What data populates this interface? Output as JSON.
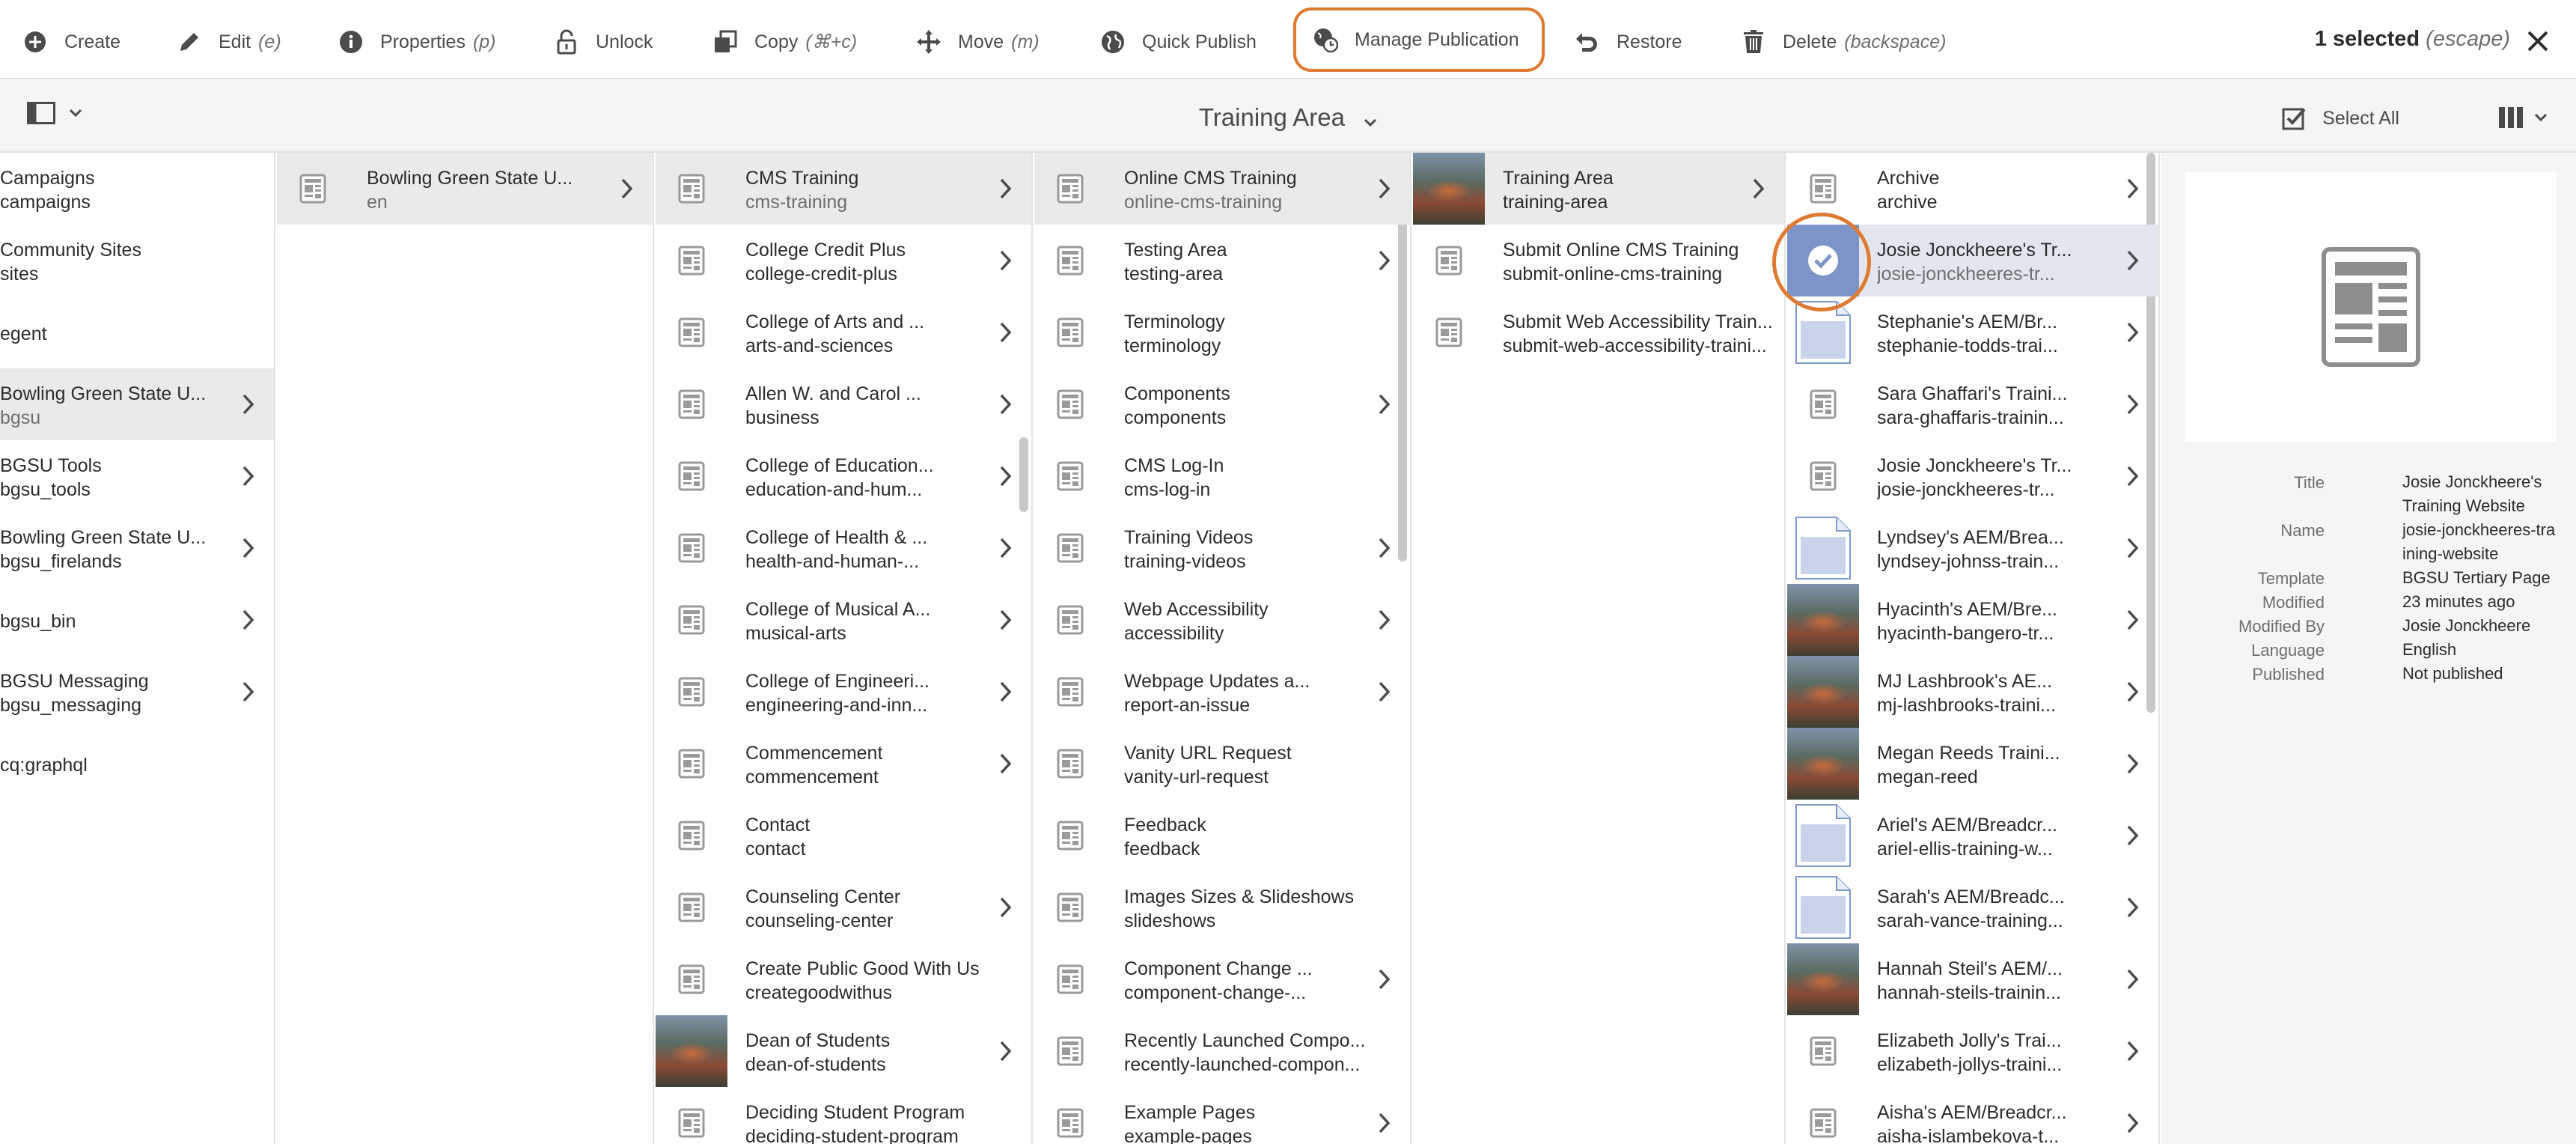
{
  "toolbar": {
    "create": "Create",
    "edit": "Edit",
    "edit_kbd": "(e)",
    "properties": "Properties",
    "properties_kbd": "(p)",
    "unlock": "Unlock",
    "copy": "Copy",
    "copy_kbd": "(⌘+c)",
    "move": "Move",
    "move_kbd": "(m)",
    "quick_publish": "Quick Publish",
    "manage_publication": "Manage Publication",
    "restore": "Restore",
    "delete": "Delete",
    "delete_kbd": "(backspace)",
    "selected_count": "1 selected",
    "selected_hint": "(escape)"
  },
  "header": {
    "title": "Training Area",
    "select_all": "Select All"
  },
  "colors": {
    "accent_highlight": "#e07a32",
    "selected_row": "#e3e6ee",
    "selected_thumb": "#7d94c9"
  },
  "columns": [
    {
      "items": [
        {
          "title": "Campaigns",
          "name": "campaigns",
          "has_children": false
        },
        {
          "title": "Community Sites",
          "name": "sites",
          "has_children": false
        },
        {
          "title": "egent",
          "name": "",
          "has_children": false
        },
        {
          "title": "Bowling Green State U...",
          "name": "bgsu",
          "has_children": true,
          "active": true
        },
        {
          "title": "BGSU Tools",
          "name": "bgsu_tools",
          "has_children": true
        },
        {
          "title": "Bowling Green State U...",
          "name": "bgsu_firelands",
          "has_children": true
        },
        {
          "title": "bgsu_bin",
          "name": "",
          "has_children": true
        },
        {
          "title": "BGSU Messaging",
          "name": "bgsu_messaging",
          "has_children": true
        },
        {
          "title": "cq:graphql",
          "name": "",
          "has_children": false
        }
      ]
    },
    {
      "items": [
        {
          "title": "Bowling Green State U...",
          "name": "en",
          "has_children": true,
          "active": true,
          "thumb": "page"
        }
      ]
    },
    {
      "items": [
        {
          "title": "CMS Training",
          "name": "cms-training",
          "has_children": true,
          "active": true,
          "thumb": "page"
        },
        {
          "title": "College Credit Plus",
          "name": "college-credit-plus",
          "has_children": true,
          "thumb": "page"
        },
        {
          "title": "College of Arts and ...",
          "name": "arts-and-sciences",
          "has_children": true,
          "thumb": "page"
        },
        {
          "title": "Allen W. and Carol ...",
          "name": "business",
          "has_children": true,
          "thumb": "page"
        },
        {
          "title": "College of Education...",
          "name": "education-and-hum...",
          "has_children": true,
          "thumb": "page"
        },
        {
          "title": "College of Health & ...",
          "name": "health-and-human-...",
          "has_children": true,
          "thumb": "page"
        },
        {
          "title": "College of Musical A...",
          "name": "musical-arts",
          "has_children": true,
          "thumb": "page"
        },
        {
          "title": "College of Engineeri...",
          "name": "engineering-and-inn...",
          "has_children": true,
          "thumb": "page"
        },
        {
          "title": "Commencement",
          "name": "commencement",
          "has_children": true,
          "thumb": "page"
        },
        {
          "title": "Contact",
          "name": "contact",
          "has_children": false,
          "thumb": "page"
        },
        {
          "title": "Counseling Center",
          "name": "counseling-center",
          "has_children": true,
          "thumb": "page"
        },
        {
          "title": "Create Public Good With Us",
          "name": "creategoodwithus",
          "has_children": false,
          "thumb": "page"
        },
        {
          "title": "Dean of Students",
          "name": "dean-of-students",
          "has_children": true,
          "thumb": "photo"
        },
        {
          "title": "Deciding Student Program",
          "name": "deciding-student-program",
          "has_children": false,
          "thumb": "page"
        }
      ]
    },
    {
      "items": [
        {
          "title": "Online CMS Training",
          "name": "online-cms-training",
          "has_children": true,
          "active": true,
          "thumb": "page"
        },
        {
          "title": "Testing Area",
          "name": "testing-area",
          "has_children": true,
          "thumb": "page"
        },
        {
          "title": "Terminology",
          "name": "terminology",
          "has_children": false,
          "thumb": "page"
        },
        {
          "title": "Components",
          "name": "components",
          "has_children": true,
          "thumb": "page"
        },
        {
          "title": "CMS Log-In",
          "name": "cms-log-in",
          "has_children": false,
          "thumb": "page"
        },
        {
          "title": "Training Videos",
          "name": "training-videos",
          "has_children": true,
          "thumb": "page"
        },
        {
          "title": "Web Accessibility",
          "name": "accessibility",
          "has_children": true,
          "thumb": "page"
        },
        {
          "title": "Webpage Updates a...",
          "name": "report-an-issue",
          "has_children": true,
          "thumb": "page"
        },
        {
          "title": "Vanity URL Request",
          "name": "vanity-url-request",
          "has_children": false,
          "thumb": "page"
        },
        {
          "title": "Feedback",
          "name": "feedback",
          "has_children": false,
          "thumb": "page"
        },
        {
          "title": "Images Sizes & Slideshows",
          "name": "slideshows",
          "has_children": false,
          "thumb": "page"
        },
        {
          "title": "Component Change ...",
          "name": "component-change-...",
          "has_children": true,
          "thumb": "page"
        },
        {
          "title": "Recently Launched Compo...",
          "name": "recently-launched-compon...",
          "has_children": false,
          "thumb": "page"
        },
        {
          "title": "Example Pages",
          "name": "example-pages",
          "has_children": true,
          "thumb": "page"
        }
      ]
    },
    {
      "items": [
        {
          "title": "Training Area",
          "name": "training-area",
          "has_children": true,
          "active": true,
          "thumb": "photo"
        },
        {
          "title": "Submit Online CMS Training",
          "name": "submit-online-cms-training",
          "has_children": false,
          "thumb": "page"
        },
        {
          "title": "Submit Web Accessibility Train...",
          "name": "submit-web-accessibility-traini...",
          "has_children": false,
          "thumb": "page"
        }
      ]
    },
    {
      "items": [
        {
          "title": "Archive",
          "name": "archive",
          "has_children": true,
          "thumb": "page"
        },
        {
          "title": "Josie Jonckheere's Tr...",
          "name": "josie-jonckheeres-tr...",
          "has_children": true,
          "thumb": "selected",
          "selected": true
        },
        {
          "title": "Stephanie's AEM/Br...",
          "name": "stephanie-todds-trai...",
          "has_children": true,
          "thumb": "doc"
        },
        {
          "title": "Sara Ghaffari's Traini...",
          "name": "sara-ghaffaris-trainin...",
          "has_children": true,
          "thumb": "page"
        },
        {
          "title": "Josie Jonckheere's Tr...",
          "name": "josie-jonckheeres-tr...",
          "has_children": true,
          "thumb": "page"
        },
        {
          "title": "Lyndsey's AEM/Brea...",
          "name": "lyndsey-johnss-train...",
          "has_children": true,
          "thumb": "doc"
        },
        {
          "title": "Hyacinth's AEM/Bre...",
          "name": "hyacinth-bangero-tr...",
          "has_children": true,
          "thumb": "photo"
        },
        {
          "title": "MJ Lashbrook's AE...",
          "name": "mj-lashbrooks-traini...",
          "has_children": true,
          "thumb": "photo"
        },
        {
          "title": "Megan Reeds Traini...",
          "name": "megan-reed",
          "has_children": true,
          "thumb": "photo"
        },
        {
          "title": "Ariel's AEM/Breadcr...",
          "name": "ariel-ellis-training-w...",
          "has_children": true,
          "thumb": "doc"
        },
        {
          "title": "Sarah's AEM/Breadc...",
          "name": "sarah-vance-training...",
          "has_children": true,
          "thumb": "doc"
        },
        {
          "title": "Hannah Steil's AEM/...",
          "name": "hannah-steils-trainin...",
          "has_children": true,
          "thumb": "photo"
        },
        {
          "title": "Elizabeth Jolly's Trai...",
          "name": "elizabeth-jollys-traini...",
          "has_children": true,
          "thumb": "page"
        },
        {
          "title": "Aisha's AEM/Breadcr...",
          "name": "aisha-islambekova-t...",
          "has_children": true,
          "thumb": "page"
        }
      ]
    }
  ],
  "details": {
    "labels": {
      "title": "Title",
      "name": "Name",
      "template": "Template",
      "modified": "Modified",
      "modified_by": "Modified By",
      "language": "Language",
      "published": "Published"
    },
    "values": {
      "title": "Josie Jonckheere's Training Website",
      "name": "josie-jonckheeres-training-website",
      "template": "BGSU Tertiary Page",
      "modified": "23 minutes ago",
      "modified_by": "Josie Jonckheere",
      "language": "English",
      "published": "Not published"
    }
  }
}
